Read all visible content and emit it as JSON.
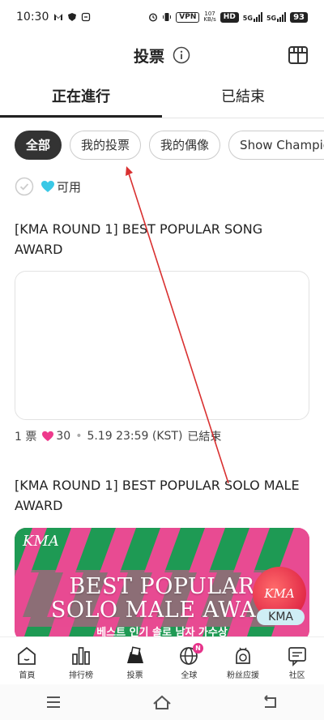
{
  "status": {
    "time": "10:30",
    "vpn": "VPN",
    "speed_top": "107",
    "speed_bottom": "KB/s",
    "hd": "HD",
    "net1": "5G",
    "net2": "5G",
    "battery": "93"
  },
  "header": {
    "title": "投票",
    "info_icon": "info-icon",
    "gift_icon": "gift-box-icon"
  },
  "tabs": [
    {
      "label": "正在進行",
      "active": true
    },
    {
      "label": "已結束",
      "active": false
    }
  ],
  "chips": [
    {
      "label": "全部",
      "active": true
    },
    {
      "label": "我的投票",
      "active": false
    },
    {
      "label": "我的偶像",
      "active": false
    },
    {
      "label": "Show Champion",
      "active": false
    }
  ],
  "filter": {
    "label": "可用"
  },
  "votes": [
    {
      "title": "[KMA ROUND 1] BEST POPULAR SONG AWARD",
      "votes": "1 票",
      "hearts": "30",
      "deadline": "5.19 23:59 (KST)",
      "status": "已結束"
    },
    {
      "title": "[KMA ROUND 1] BEST POPULAR SOLO MALE AWARD",
      "banner_line1": "BEST POPULAR",
      "banner_line2": "SOLO MALE AWAR",
      "banner_sub": "베스트 인기 솔로 남자 가수상",
      "logo_text": "KMA",
      "badge_text": "KMA",
      "tag": "KMA"
    }
  ],
  "bottom_nav": [
    {
      "label": "首頁",
      "icon": "home-icon"
    },
    {
      "label": "排行榜",
      "icon": "bar-chart-icon"
    },
    {
      "label": "投票",
      "icon": "vote-icon"
    },
    {
      "label": "全球",
      "icon": "globe-icon",
      "badge": "N"
    },
    {
      "label": "粉丝应援",
      "icon": "fan-support-icon"
    },
    {
      "label": "社区",
      "icon": "community-icon"
    }
  ],
  "system_nav": [
    "menu-icon",
    "home-outline-icon",
    "back-icon"
  ],
  "colors": {
    "heart_cyan": "#3ac8e6",
    "heart_pink": "#ee3a8c",
    "arrow": "#d93030",
    "banner_pink": "#e84b92",
    "banner_green": "#1e9a54"
  }
}
